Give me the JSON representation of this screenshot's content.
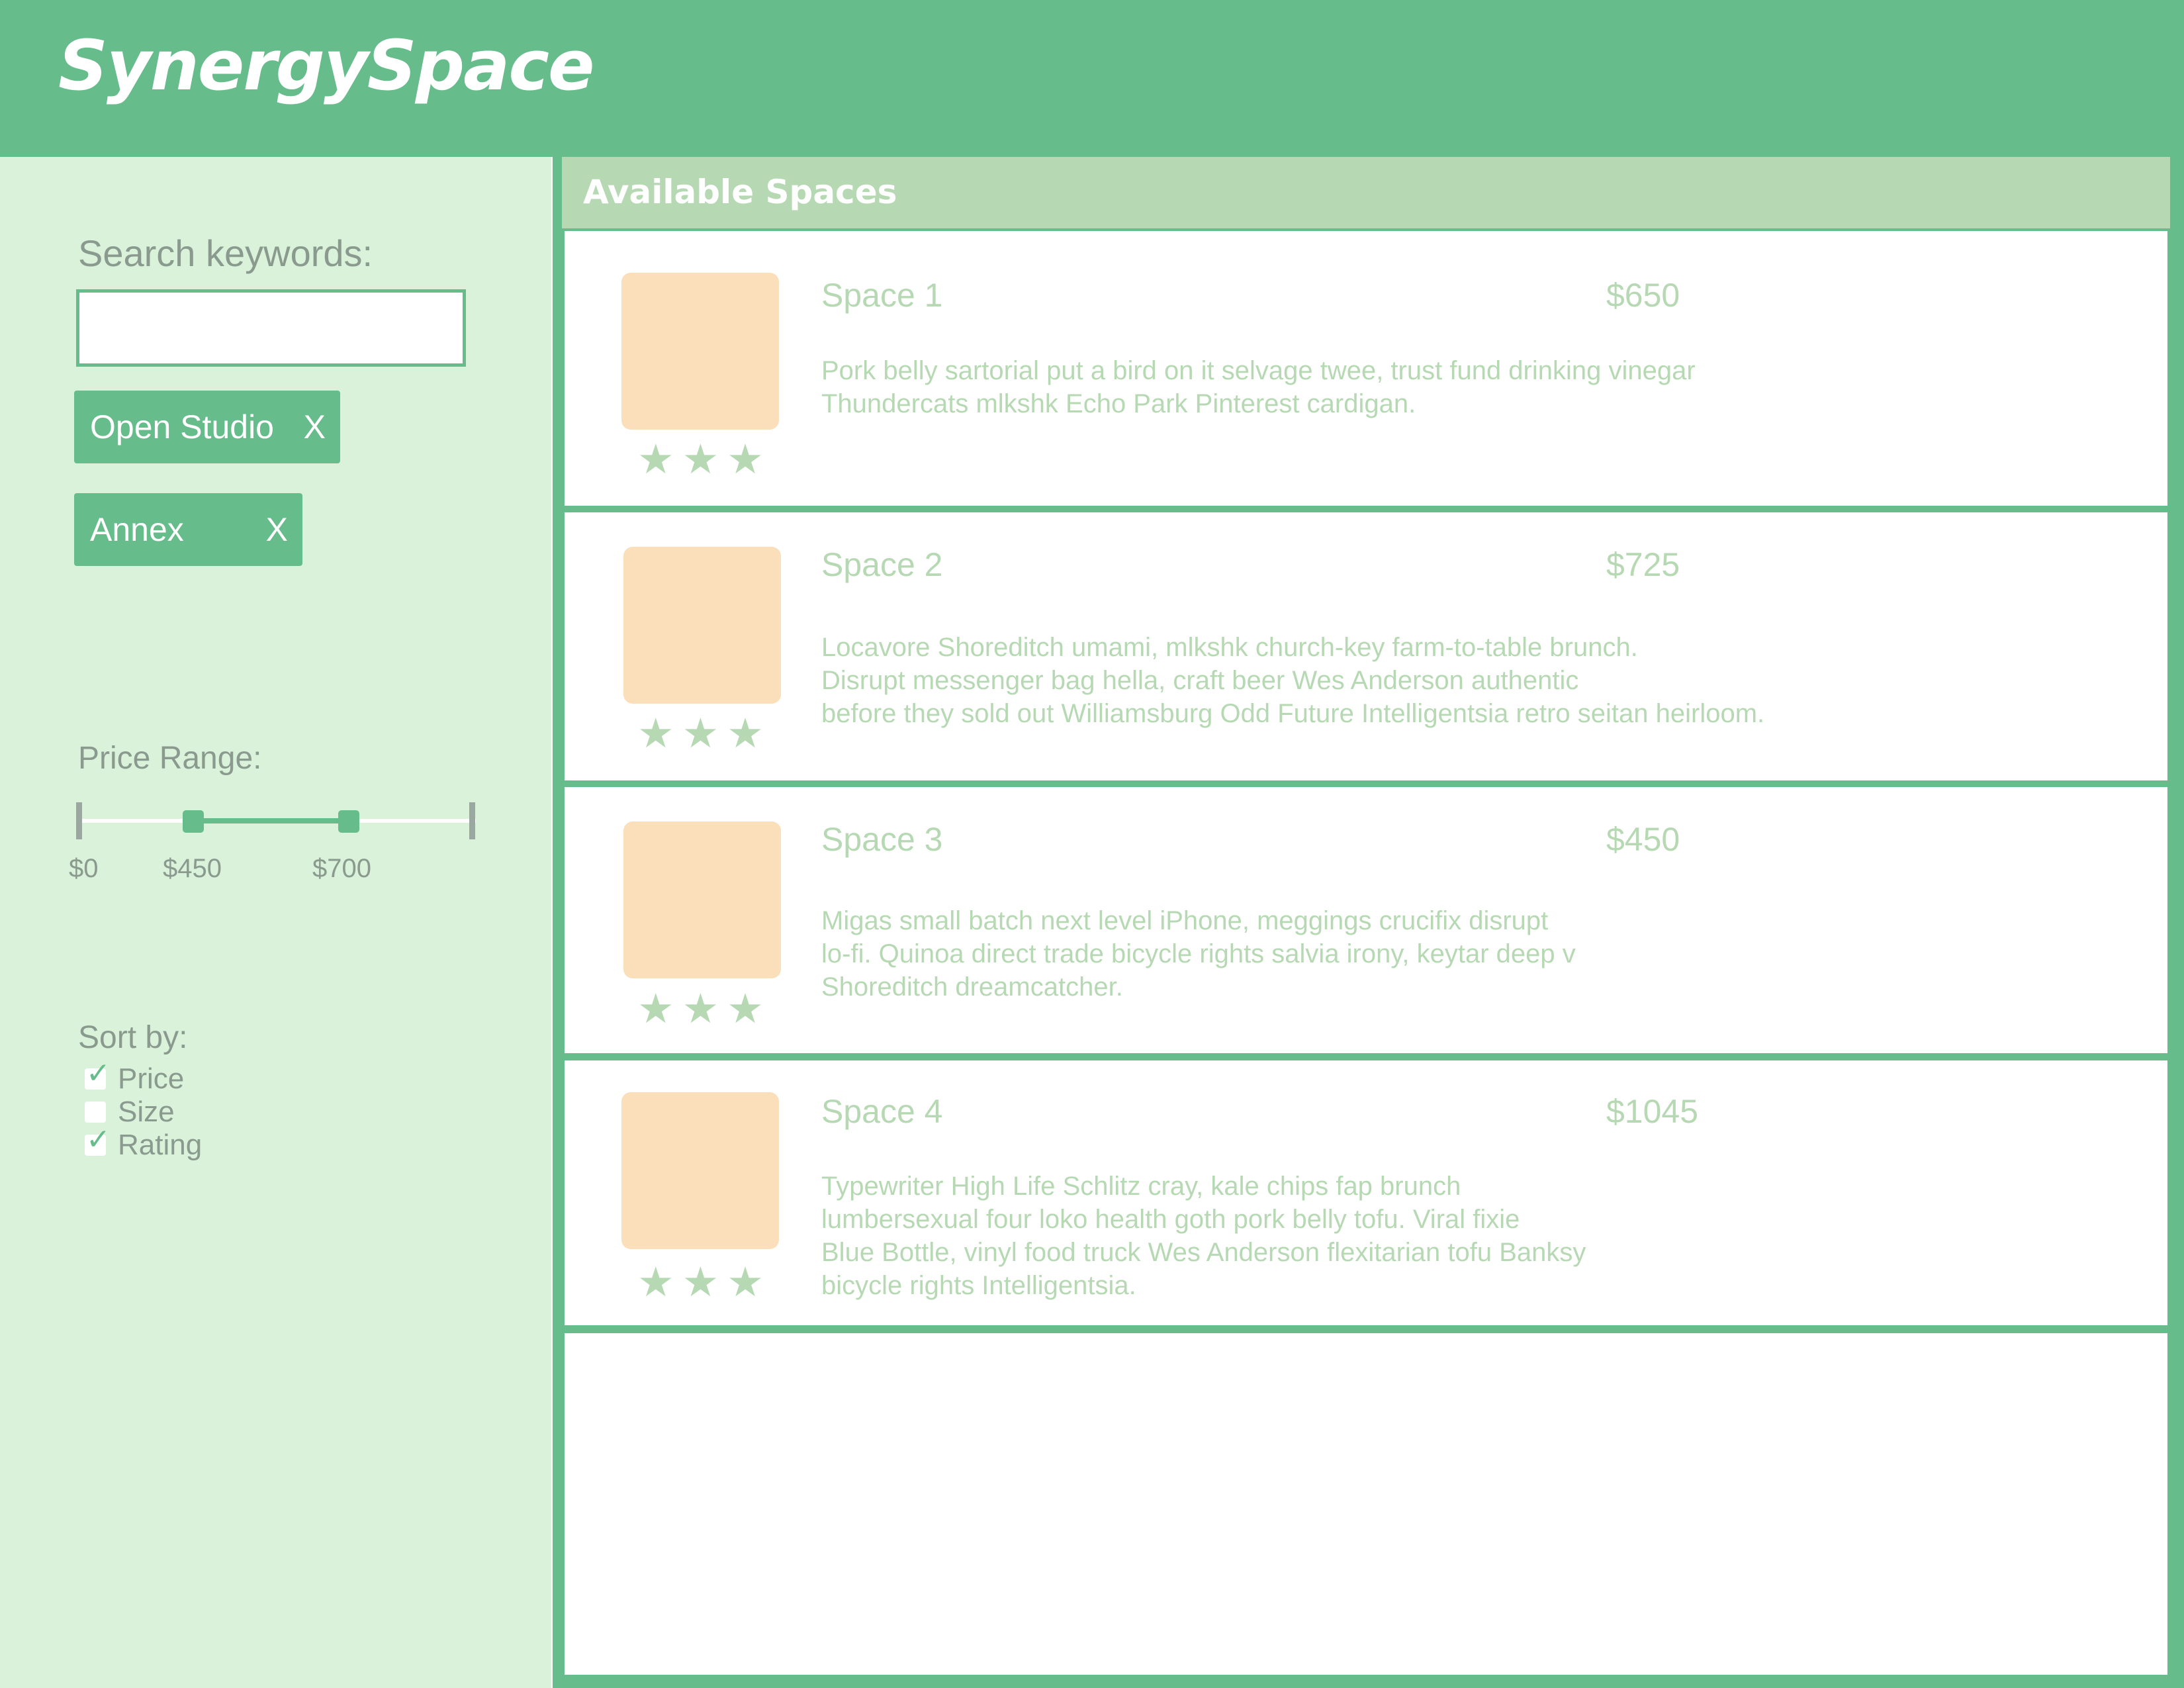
{
  "header": {
    "brand": "SynergySpace"
  },
  "sidebar": {
    "search": {
      "label": "Search keywords:",
      "value": "",
      "placeholder": ""
    },
    "tags": [
      {
        "label": "Open Studio",
        "remove": "X"
      },
      {
        "label": "Annex",
        "remove": "X"
      }
    ],
    "price_range": {
      "label": "Price Range:",
      "min_label": "$0",
      "low_value": "$450",
      "high_value": "$700"
    },
    "sort": {
      "label": "Sort by:",
      "options": [
        {
          "label": "Price",
          "checked": true
        },
        {
          "label": "Size",
          "checked": false
        },
        {
          "label": "Rating",
          "checked": true
        }
      ]
    }
  },
  "main": {
    "title": "Available Spaces",
    "star_glyph": "★",
    "spaces": [
      {
        "name": "Space 1",
        "price": "$650",
        "rating_stars": 3,
        "description": [
          "Pork belly sartorial put a bird on it selvage twee, trust fund drinking vinegar",
          "Thundercats mlkshk Echo Park Pinterest cardigan."
        ]
      },
      {
        "name": "Space 2",
        "price": "$725",
        "rating_stars": 3,
        "description": [
          "Locavore Shoreditch umami, mlkshk church-key farm-to-table brunch.",
          "Disrupt messenger bag hella, craft beer Wes Anderson authentic",
          "before they sold out Williamsburg Odd Future Intelligentsia retro seitan heirloom."
        ]
      },
      {
        "name": "Space 3",
        "price": "$450",
        "rating_stars": 3,
        "description": [
          "Migas small batch next level iPhone, meggings crucifix disrupt",
          "lo-fi. Quinoa direct trade bicycle rights salvia irony, keytar deep v",
          "Shoreditch dreamcatcher."
        ]
      },
      {
        "name": "Space 4",
        "price": "$1045",
        "rating_stars": 3,
        "description": [
          "Typewriter High Life Schlitz cray, kale chips fap brunch",
          "lumbersexual four loko health goth pork belly tofu. Viral fixie",
          "Blue Bottle, vinyl food truck Wes Anderson flexitarian tofu Banksy",
          "bicycle rights Intelligentsia."
        ]
      }
    ]
  },
  "colors": {
    "brand_green": "#66bc8b",
    "sidebar_bg": "#d9f2d9",
    "panel_header": "#b6d9b3",
    "thumbnail": "#fbdeba",
    "muted_text": "#8a9a8f"
  },
  "icons": {
    "remove_tag": "x-icon",
    "rating": "star-icon",
    "checkbox_checked": "check-icon"
  }
}
